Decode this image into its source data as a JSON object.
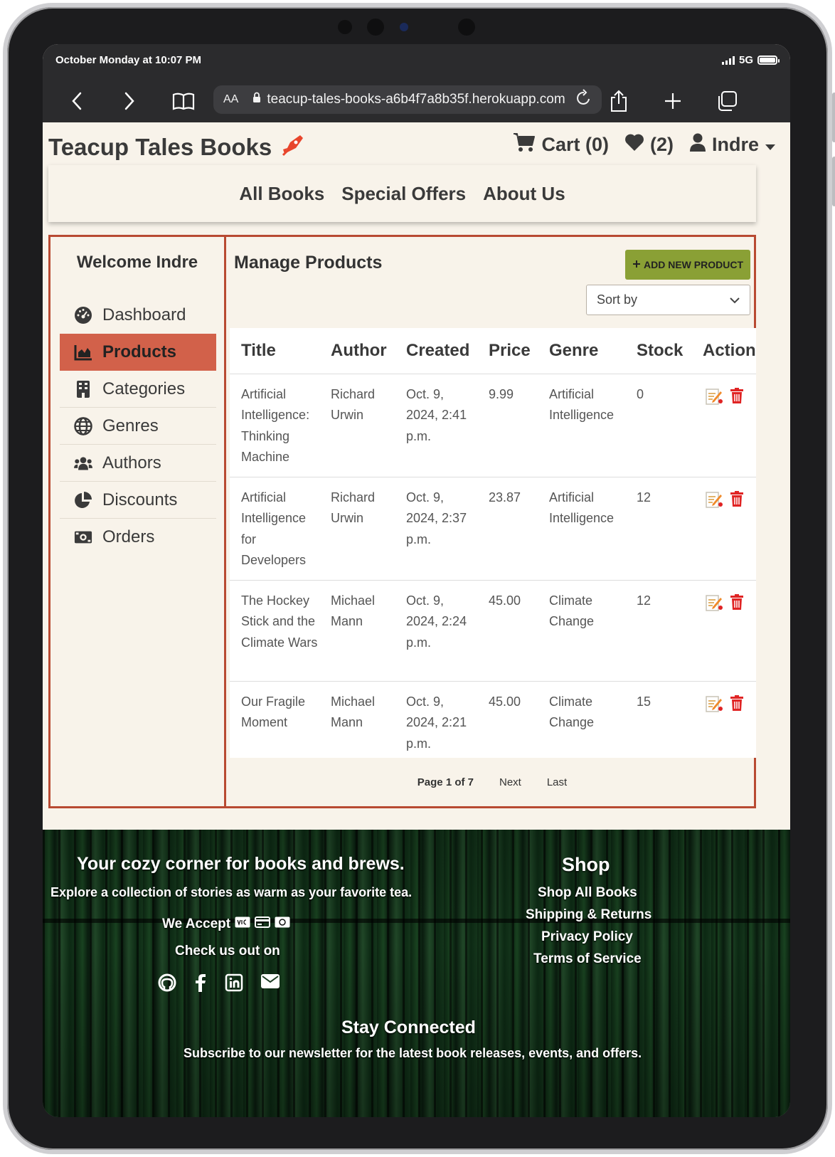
{
  "status_bar": {
    "time": "October Monday at 10:07 PM",
    "network": "5G"
  },
  "browser": {
    "text_size_label": "AA",
    "url": "teacup-tales-books-a6b4f7a8b35f.herokuapp.com"
  },
  "header": {
    "brand": "Teacup Tales Books",
    "cart_label": "Cart (0)",
    "wishlist_count": "(2)",
    "user_name": "Indre"
  },
  "nav": {
    "items": [
      "All Books",
      "Special Offers",
      "About Us"
    ]
  },
  "sidebar": {
    "welcome": "Welcome Indre",
    "items": [
      {
        "label": "Dashboard",
        "icon": "dashboard-icon"
      },
      {
        "label": "Products",
        "icon": "chart-area-icon",
        "active": true
      },
      {
        "label": "Categories",
        "icon": "building-icon"
      },
      {
        "label": "Genres",
        "icon": "globe-icon"
      },
      {
        "label": "Authors",
        "icon": "users-icon"
      },
      {
        "label": "Discounts",
        "icon": "pie-chart-icon"
      },
      {
        "label": "Orders",
        "icon": "money-bill-icon"
      }
    ]
  },
  "main": {
    "title": "Manage Products",
    "add_button": "ADD NEW PRODUCT",
    "sort_label": "Sort by",
    "table": {
      "columns": [
        "Title",
        "Author",
        "Created",
        "Price",
        "Genre",
        "Stock",
        "Actions"
      ],
      "rows": [
        {
          "title": "Artificial Intelligence: Thinking Machine",
          "author": "Richard Urwin",
          "created": "Oct. 9, 2024, 2:41 p.m.",
          "price": "9.99",
          "genre": "Artificial Intelligence",
          "stock": "0"
        },
        {
          "title": "Artificial Intelligence for Developers",
          "author": "Richard Urwin",
          "created": "Oct. 9, 2024, 2:37 p.m.",
          "price": "23.87",
          "genre": "Artificial Intelligence",
          "stock": "12"
        },
        {
          "title": "The Hockey Stick and the Climate Wars",
          "author": "Michael Mann",
          "created": "Oct. 9, 2024, 2:24 p.m.",
          "price": "45.00",
          "genre": "Climate Change",
          "stock": "12"
        },
        {
          "title": "Our Fragile Moment",
          "author": "Michael Mann",
          "created": "Oct. 9, 2024, 2:21 p.m.",
          "price": "45.00",
          "genre": "Climate Change",
          "stock": "15"
        }
      ]
    },
    "pagination": {
      "current": "Page 1 of 7",
      "next": "Next",
      "last": "Last"
    }
  },
  "footer": {
    "tagline": "Your cozy corner for books and brews.",
    "subtagline": "Explore a collection of stories as warm as your favorite tea.",
    "we_accept": "We Accept",
    "check_us_out": "Check us out on",
    "shop_title": "Shop",
    "shop_links": [
      "Shop All Books",
      "Shipping & Returns",
      "Privacy Policy",
      "Terms of Service"
    ],
    "stay_connected": "Stay Connected",
    "newsletter_text": "Subscribe to our newsletter for the latest book releases, events, and offers."
  },
  "colors": {
    "accent": "#b84a32",
    "active_item": "#d2614a",
    "add_button": "#8aa035",
    "background": "#f8f3ea",
    "delete_icon": "#e02424"
  }
}
